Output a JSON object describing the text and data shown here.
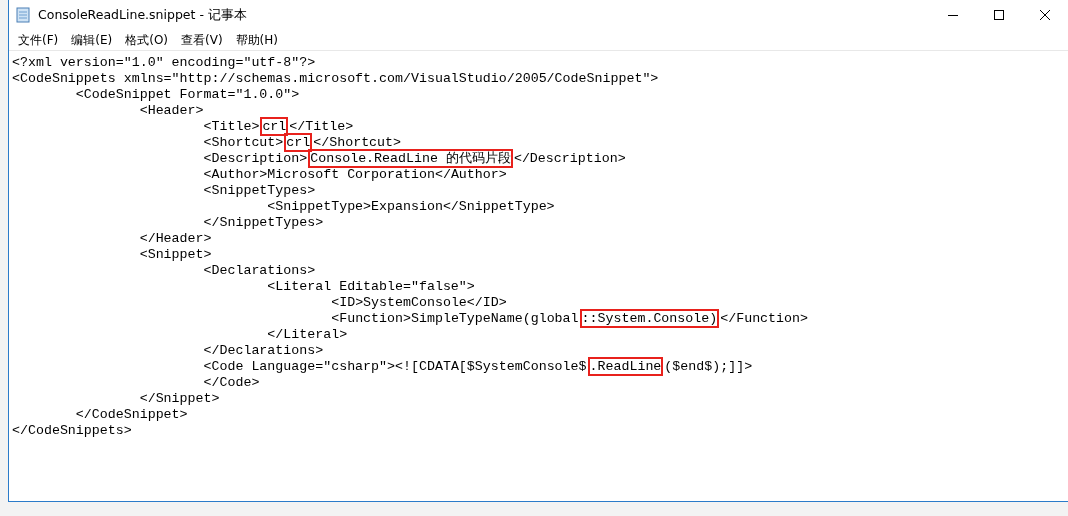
{
  "window": {
    "title": "ConsoleReadLine.snippet - 记事本"
  },
  "menu": [
    {
      "label": "文件(F)"
    },
    {
      "label": "编辑(E)"
    },
    {
      "label": "格式(O)"
    },
    {
      "label": "查看(V)"
    },
    {
      "label": "帮助(H)"
    }
  ],
  "lines": [
    {
      "segments": [
        {
          "text": "<?xml version=\"1.0\" encoding=\"utf-8\"?>",
          "boxed": false
        }
      ]
    },
    {
      "segments": [
        {
          "text": "<CodeSnippets xmlns=\"http://schemas.microsoft.com/VisualStudio/2005/CodeSnippet\">",
          "boxed": false
        }
      ]
    },
    {
      "segments": [
        {
          "text": "\t<CodeSnippet Format=\"1.0.0\">",
          "boxed": false
        }
      ]
    },
    {
      "segments": [
        {
          "text": "\t\t<Header>",
          "boxed": false
        }
      ]
    },
    {
      "segments": [
        {
          "text": "\t\t\t<Title>",
          "boxed": false
        },
        {
          "text": "crl",
          "boxed": true
        },
        {
          "text": "</Title>",
          "boxed": false
        }
      ]
    },
    {
      "segments": [
        {
          "text": "\t\t\t<Shortcut>",
          "boxed": false
        },
        {
          "text": "crl",
          "boxed": true
        },
        {
          "text": "</Shortcut>",
          "boxed": false
        }
      ]
    },
    {
      "segments": [
        {
          "text": "\t\t\t<Description>",
          "boxed": false
        },
        {
          "text": "Console.ReadLine 的代码片段",
          "boxed": true
        },
        {
          "text": "</Description>",
          "boxed": false
        }
      ]
    },
    {
      "segments": [
        {
          "text": "\t\t\t<Author>Microsoft Corporation</Author>",
          "boxed": false
        }
      ]
    },
    {
      "segments": [
        {
          "text": "\t\t\t<SnippetTypes>",
          "boxed": false
        }
      ]
    },
    {
      "segments": [
        {
          "text": "\t\t\t\t<SnippetType>Expansion</SnippetType>",
          "boxed": false
        }
      ]
    },
    {
      "segments": [
        {
          "text": "\t\t\t</SnippetTypes>",
          "boxed": false
        }
      ]
    },
    {
      "segments": [
        {
          "text": "\t\t</Header>",
          "boxed": false
        }
      ]
    },
    {
      "segments": [
        {
          "text": "\t\t<Snippet>",
          "boxed": false
        }
      ]
    },
    {
      "segments": [
        {
          "text": "\t\t\t<Declarations>",
          "boxed": false
        }
      ]
    },
    {
      "segments": [
        {
          "text": "\t\t\t\t<Literal Editable=\"false\">",
          "boxed": false
        }
      ]
    },
    {
      "segments": [
        {
          "text": "\t\t\t\t\t<ID>SystemConsole</ID>",
          "boxed": false
        }
      ]
    },
    {
      "segments": [
        {
          "text": "\t\t\t\t\t<Function>SimpleTypeName(global",
          "boxed": false
        },
        {
          "text": "::System.Console)",
          "boxed": true
        },
        {
          "text": "</Function>",
          "boxed": false
        }
      ]
    },
    {
      "segments": [
        {
          "text": "\t\t\t\t</Literal>",
          "boxed": false
        }
      ]
    },
    {
      "segments": [
        {
          "text": "\t\t\t</Declarations>",
          "boxed": false
        }
      ]
    },
    {
      "segments": [
        {
          "text": "\t\t\t<Code Language=\"csharp\"><![CDATA[$SystemConsole$",
          "boxed": false
        },
        {
          "text": ".ReadLine",
          "boxed": true
        },
        {
          "text": "($end$);]]>",
          "boxed": false
        }
      ]
    },
    {
      "segments": [
        {
          "text": "\t\t\t</Code>",
          "boxed": false
        }
      ]
    },
    {
      "segments": [
        {
          "text": "\t\t</Snippet>",
          "boxed": false
        }
      ]
    },
    {
      "segments": [
        {
          "text": "\t</CodeSnippet>",
          "boxed": false
        }
      ]
    },
    {
      "segments": [
        {
          "text": "</CodeSnippets>",
          "boxed": false
        }
      ]
    }
  ]
}
